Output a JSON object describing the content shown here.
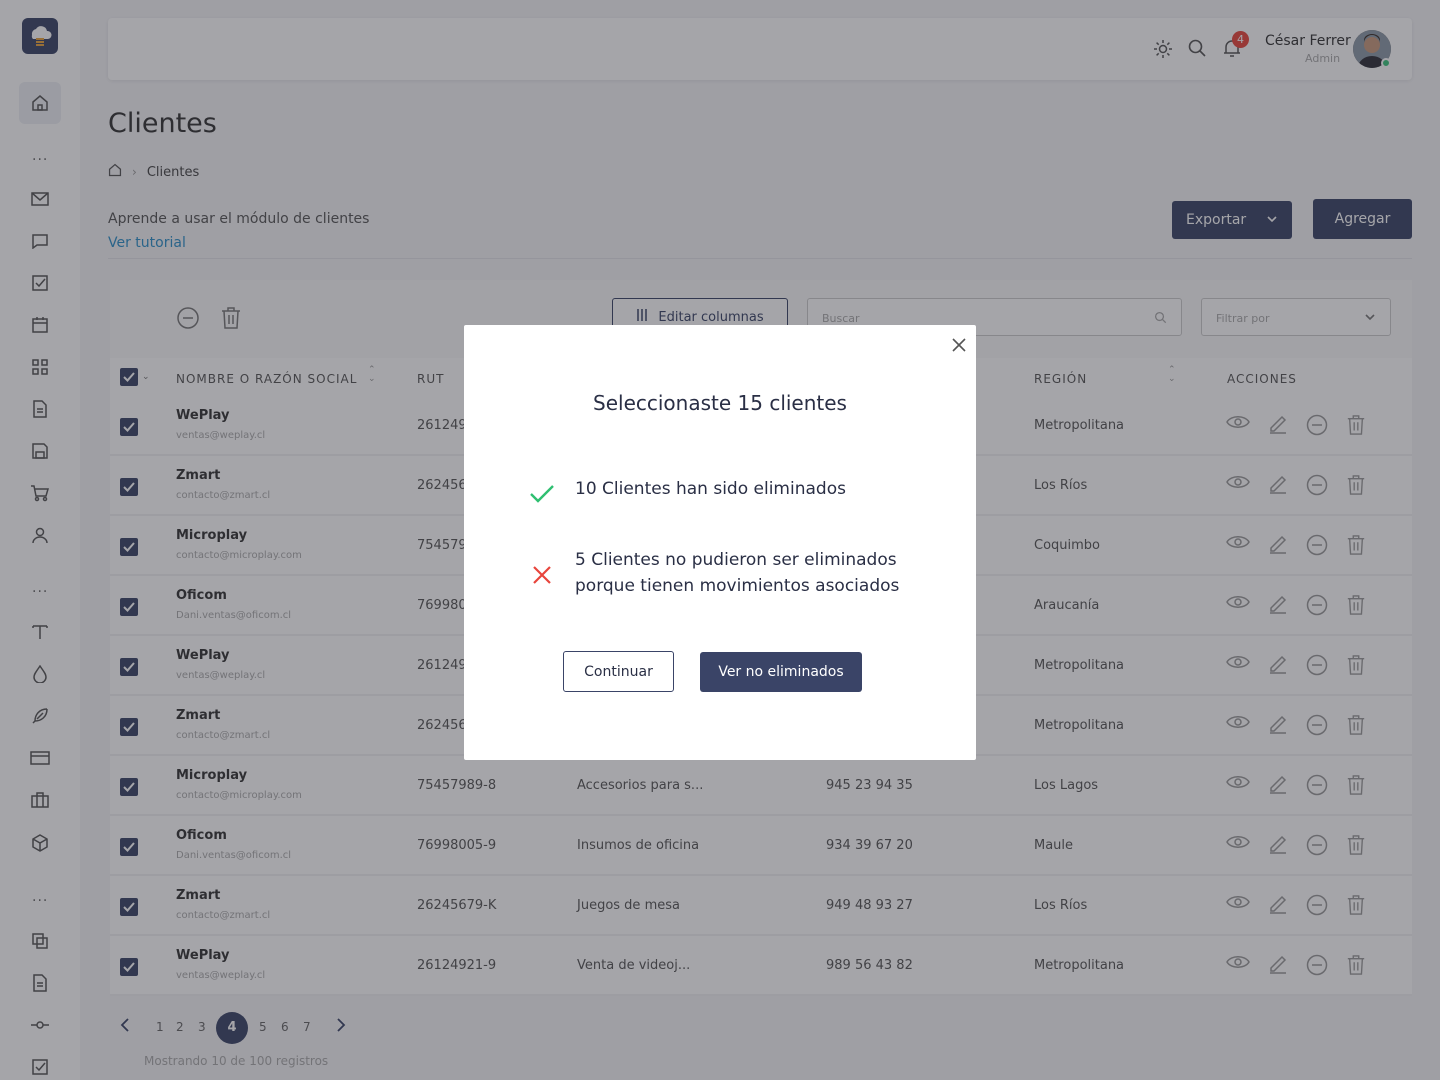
{
  "header": {
    "notification_count": "4",
    "user_name": "César Ferrer",
    "user_role": "Admin"
  },
  "page": {
    "title": "Clientes",
    "breadcrumb_current": "Clientes",
    "learn_text": "Aprende a usar el módulo de clientes",
    "tutorial_link": "Ver tutorial",
    "export_label": "Exportar",
    "add_label": "Agregar"
  },
  "toolbar": {
    "edit_columns_label": "Editar columnas",
    "search_placeholder": "Buscar",
    "filter_placeholder": "Filtrar por"
  },
  "table": {
    "headers": {
      "name": "NOMBRE O RAZÓN SOCIAL",
      "rut": "RUT",
      "region": "REGIÓN",
      "actions": "ACCIONES"
    },
    "rows": [
      {
        "name": "WePlay",
        "email": "ventas@weplay.cl",
        "rut": "261249",
        "giro": "",
        "phone": "",
        "region": "Metropolitana"
      },
      {
        "name": "Zmart",
        "email": "contacto@zmart.cl",
        "rut": "262456",
        "giro": "",
        "phone": "",
        "region": "Los Ríos"
      },
      {
        "name": "Microplay",
        "email": "contacto@microplay.com",
        "rut": "754579",
        "giro": "",
        "phone": "",
        "region": "Coquimbo"
      },
      {
        "name": "Oficom",
        "email": "Dani.ventas@oficom.cl",
        "rut": "769980",
        "giro": "",
        "phone": "",
        "region": "Araucanía"
      },
      {
        "name": "WePlay",
        "email": "ventas@weplay.cl",
        "rut": "261249",
        "giro": "",
        "phone": "",
        "region": "Metropolitana"
      },
      {
        "name": "Zmart",
        "email": "contacto@zmart.cl",
        "rut": "262456",
        "giro": "",
        "phone": "",
        "region": "Metropolitana"
      },
      {
        "name": "Microplay",
        "email": "contacto@microplay.com",
        "rut": "75457989-8",
        "giro": "Accesorios para s...",
        "phone": "945 23 94 35",
        "region": "Los Lagos"
      },
      {
        "name": "Oficom",
        "email": "Dani.ventas@oficom.cl",
        "rut": "76998005-9",
        "giro": "Insumos de oficina",
        "phone": "934 39 67 20",
        "region": "Maule"
      },
      {
        "name": "Zmart",
        "email": "contacto@zmart.cl",
        "rut": "26245679-K",
        "giro": "Juegos de mesa",
        "phone": "949 48 93 27",
        "region": "Los Ríos"
      },
      {
        "name": "WePlay",
        "email": "ventas@weplay.cl",
        "rut": "26124921-9",
        "giro": "Venta de videoj...",
        "phone": "989 56 43 82",
        "region": "Metropolitana"
      }
    ]
  },
  "pagination": {
    "pages": [
      "1",
      "2",
      "3",
      "4",
      "5",
      "6",
      "7"
    ],
    "current": "4",
    "showing": "Mostrando 10 de 100 registros"
  },
  "modal": {
    "title": "Seleccionaste 15 clientes",
    "success_msg": "10 Clientes han sido eliminados",
    "error_msg_line1": "5 Clientes no pudieron ser eliminados",
    "error_msg_line2": "porque tienen movimientos asociados",
    "continue_label": "Continuar",
    "view_label": "Ver no eliminados"
  },
  "colors": {
    "primary": "#3a4467",
    "success": "#2fbf71",
    "error": "#e8453c",
    "link": "#2c8fc9"
  }
}
